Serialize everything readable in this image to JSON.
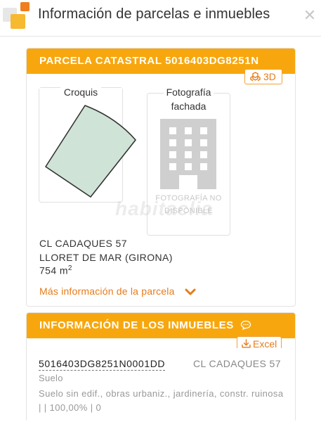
{
  "header": {
    "title": "Información de parcelas e inmuebles",
    "close_glyph": "✕"
  },
  "parcela": {
    "title": "PARCELA CATASTRAL 5016403DG8251N",
    "btn_3d_label": "3D",
    "croquis_label": "Croquis",
    "foto_label_line1": "Fotografía",
    "foto_label_line2": "fachada",
    "no_disponible_line1": "FOTOGRAFÍA NO",
    "no_disponible_line2": "DISPONIBLE",
    "watermark": "habitaclia",
    "address_line1": "CL CADAQUES 57",
    "address_line2": "LLORET DE MAR (GIRONA)",
    "area_value": "754 m",
    "area_sup": "2",
    "more_link": "Más información de la parcela"
  },
  "inmuebles": {
    "title": "INFORMACIÓN DE LOS INMUEBLES",
    "excel_label": "Excel",
    "items": [
      {
        "ref": "5016403DG8251N0001DD",
        "street": "CL CADAQUES 57",
        "use": "Suelo",
        "desc": "Suelo sin edif., obras urbaniz., jardinería, constr. ruinosa | | 100,00% | 0"
      }
    ]
  },
  "icons": {
    "logo": "habitaclia-logo",
    "close": "close-icon",
    "cubes": "cubes-3d-icon",
    "building": "building-icon",
    "chevron": "chevron-down-icon",
    "chat": "chat-bubble-icon",
    "download": "download-icon"
  },
  "colors": {
    "accent": "#f7a70d",
    "link": "#e67c1a",
    "parcel_fill": "#cfe3d6"
  }
}
